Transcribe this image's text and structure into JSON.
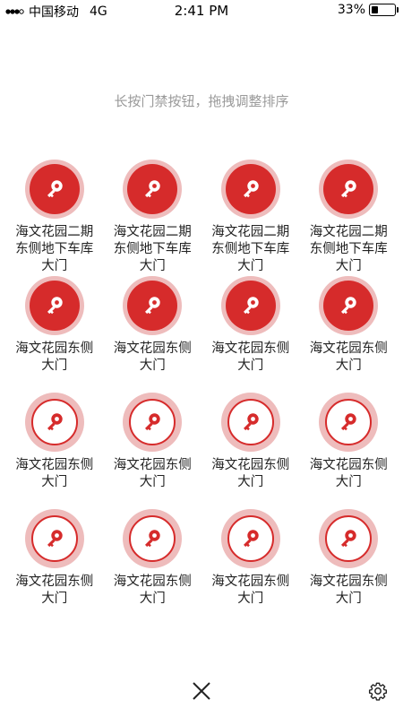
{
  "status_bar": {
    "carrier": "中国移动",
    "network": "4G",
    "time": "2:41 PM",
    "battery_text": "33%",
    "battery_level": 0.33
  },
  "hint": "长按门禁按钮，拖拽调整排序",
  "doors": [
    {
      "label": "海文花园二期东侧地下车库大门",
      "style": "filled",
      "icon": "key-icon"
    },
    {
      "label": "海文花园二期东侧地下车库大门",
      "style": "filled",
      "icon": "key-icon"
    },
    {
      "label": "海文花园二期东侧地下车库大门",
      "style": "filled",
      "icon": "key-icon"
    },
    {
      "label": "海文花园二期东侧地下车库大门",
      "style": "filled",
      "icon": "key-icon"
    },
    {
      "label": "海文花园东侧大门",
      "style": "filled",
      "icon": "key-icon"
    },
    {
      "label": "海文花园东侧大门",
      "style": "filled",
      "icon": "key-icon"
    },
    {
      "label": "海文花园东侧大门",
      "style": "filled",
      "icon": "key-icon"
    },
    {
      "label": "海文花园东侧大门",
      "style": "filled",
      "icon": "key-icon"
    },
    {
      "label": "海文花园东侧大门",
      "style": "outline",
      "icon": "key-icon"
    },
    {
      "label": "海文花园东侧大门",
      "style": "outline",
      "icon": "key-icon"
    },
    {
      "label": "海文花园东侧大门",
      "style": "outline",
      "icon": "key-icon"
    },
    {
      "label": "海文花园东侧大门",
      "style": "outline",
      "icon": "key-icon"
    },
    {
      "label": "海文花园东侧大门",
      "style": "outline",
      "icon": "key-icon"
    },
    {
      "label": "海文花园东侧大门",
      "style": "outline",
      "icon": "key-icon"
    },
    {
      "label": "海文花园东侧大门",
      "style": "outline",
      "icon": "key-icon"
    },
    {
      "label": "海文花园东侧大门",
      "style": "outline",
      "icon": "key-icon"
    }
  ],
  "bottom_bar": {
    "close_icon": "close-icon",
    "settings_icon": "gear-icon"
  },
  "colors": {
    "accent": "#d62b2b",
    "ring": "#eebcbc",
    "hint": "#9a9a9a"
  }
}
